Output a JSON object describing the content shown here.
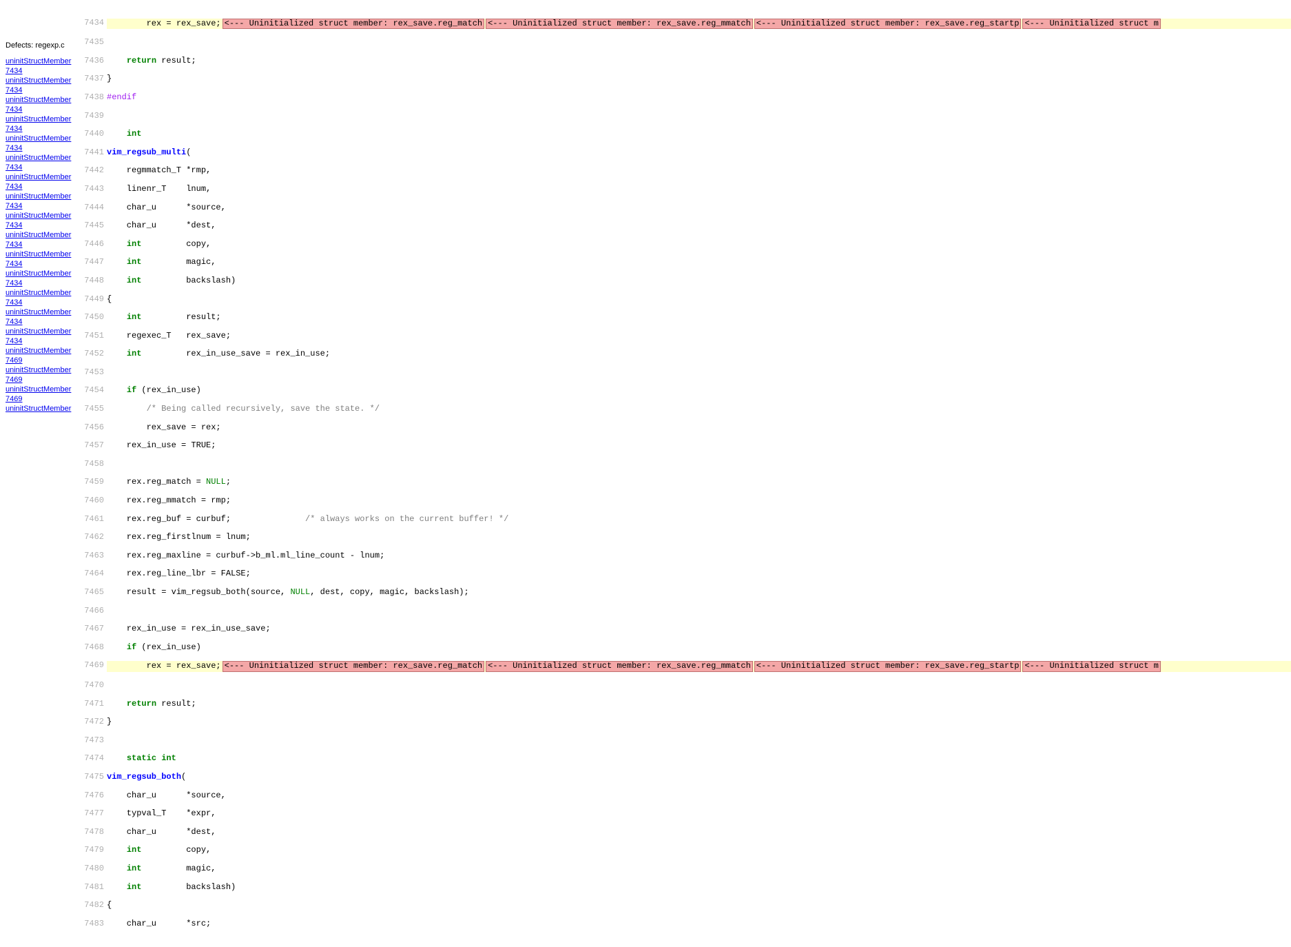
{
  "sidebar": {
    "defects_label": "Defects:",
    "filename": "regexp.c",
    "links": [
      {
        "label": "uninitStructMember",
        "line": "7434"
      },
      {
        "label": "uninitStructMember",
        "line": "7434"
      },
      {
        "label": "uninitStructMember",
        "line": "7434"
      },
      {
        "label": "uninitStructMember",
        "line": "7434"
      },
      {
        "label": "uninitStructMember",
        "line": "7434"
      },
      {
        "label": "uninitStructMember",
        "line": "7434"
      },
      {
        "label": "uninitStructMember",
        "line": "7434"
      },
      {
        "label": "uninitStructMember",
        "line": "7434"
      },
      {
        "label": "uninitStructMember",
        "line": "7434"
      },
      {
        "label": "uninitStructMember",
        "line": "7434"
      },
      {
        "label": "uninitStructMember",
        "line": "7434"
      },
      {
        "label": "uninitStructMember",
        "line": "7434"
      },
      {
        "label": "uninitStructMember",
        "line": "7434"
      },
      {
        "label": "uninitStructMember",
        "line": "7434"
      },
      {
        "label": "uninitStructMember",
        "line": "7434"
      },
      {
        "label": "uninitStructMember",
        "line": "7469"
      },
      {
        "label": "uninitStructMember",
        "line": "7469"
      },
      {
        "label": "uninitStructMember",
        "line": "7469"
      },
      {
        "label": "uninitStructMember",
        "line": ""
      }
    ]
  },
  "linenos": {
    "start": 7434,
    "end": 7483
  },
  "tok": {
    "int": "int",
    "return": "return",
    "if": "if",
    "static": "static",
    "endif": "#endif",
    "NULL": "NULL"
  },
  "txt": {
    "l7434": "\trex = rex_save;",
    "l7436": "result;",
    "l7437": "}",
    "l7439": "",
    "l7441_fn": "vim_regsub_multi",
    "l7441_rest": "(",
    "l7442": "    regmmatch_T *rmp,",
    "l7443": "    linenr_T\tlnum,",
    "l7444": "    char_u\t*source,",
    "l7445": "    char_u\t*dest,",
    "l7446_a": "    ",
    "l7446_b": "\t\tcopy,",
    "l7447_b": "\t\tmagic,",
    "l7448_b": "\t\tbackslash)",
    "l7449": "{",
    "l7450_b": "\t\tresult;",
    "l7451": "    regexec_T   rex_save;",
    "l7452_b": "\t\trex_in_use_save = rex_in_use;",
    "l7454_b": " (rex_in_use)",
    "l7455_cmt": "\t/* Being called recursively, save the state. */",
    "l7456": "\trex_save = rex;",
    "l7457": "    rex_in_use = TRUE;",
    "l7459": "    rex.reg_match = ",
    "l7459_b": ";",
    "l7460": "    rex.reg_mmatch = rmp;",
    "l7461": "    rex.reg_buf = curbuf;\t\t",
    "l7461_cmt": "/* always works on the current buffer! */",
    "l7462": "    rex.reg_firstlnum = lnum;",
    "l7463": "    rex.reg_maxline = curbuf->b_ml.ml_line_count - lnum;",
    "l7464": "    rex.reg_line_lbr = FALSE;",
    "l7465_a": "    result = vim_regsub_both(source, ",
    "l7465_b": ", dest, copy, magic, backslash);",
    "l7467": "    rex_in_use = rex_in_use_save;",
    "l7468_b": " (rex_in_use)",
    "l7469": "\trex = rex_save;",
    "l7471": "result;",
    "l7472": "}",
    "l7475_fn": "vim_regsub_both",
    "l7475_rest": "(",
    "l7476": "    char_u\t*source,",
    "l7477": "    typval_T\t*expr,",
    "l7478": "    char_u\t*dest,",
    "l7483": "    char_u\t*src;"
  },
  "err": {
    "e1": "<--- Uninitialized struct member: rex_save.reg_match",
    "e2": "<--- Uninitialized struct member: rex_save.reg_mmatch",
    "e3": "<--- Uninitialized struct member: rex_save.reg_startp",
    "e4": "<--- Uninitialized struct m"
  }
}
